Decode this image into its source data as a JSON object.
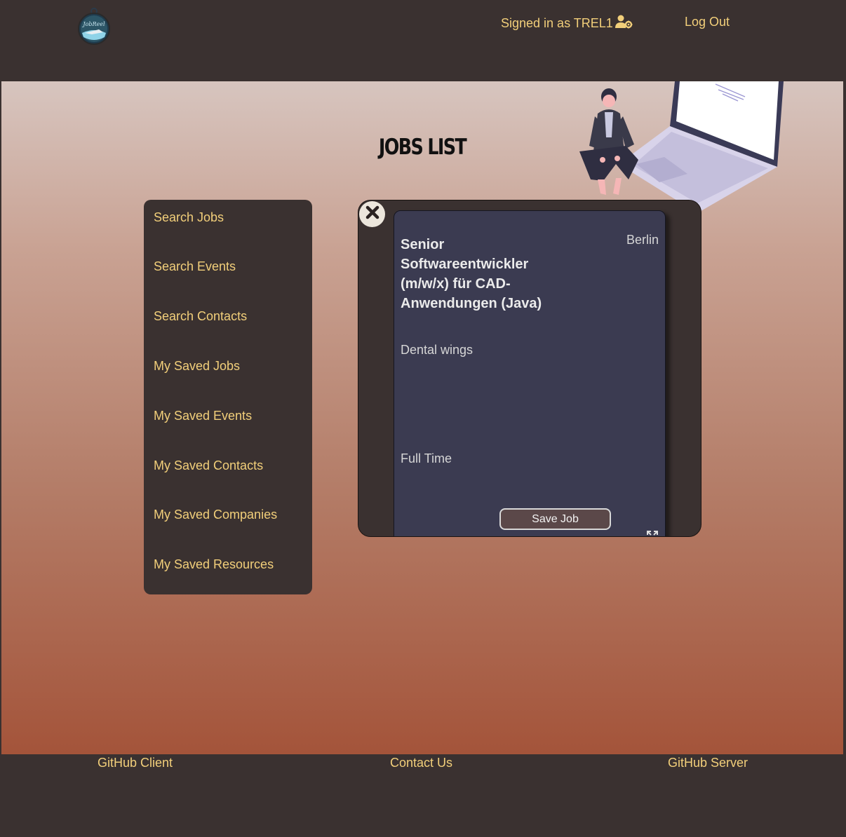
{
  "header": {
    "signed_in_text": "Signed in as TREL1",
    "user_icon": "user-gear-icon",
    "logout_label": "Log Out",
    "logo_icon": "jobreel-logo",
    "logo_text": "JobReel"
  },
  "main": {
    "title": "JOBS LIST",
    "illustration": "woman-sitting-on-laptop-illustration"
  },
  "sidebar": {
    "items": [
      {
        "label": "Search Jobs"
      },
      {
        "label": "Search Events"
      },
      {
        "label": "Search Contacts"
      },
      {
        "label": "My Saved Jobs"
      },
      {
        "label": "My Saved Events"
      },
      {
        "label": "My Saved Contacts"
      },
      {
        "label": "My Saved Companies"
      },
      {
        "label": "My Saved Resources"
      }
    ]
  },
  "job_card": {
    "title": "Senior Softwareentwickler (m/w/x) für CAD-Anwendungen (Java)",
    "location": "Berlin",
    "company": "Dental wings",
    "type": "Full Time",
    "save_label": "Save Job",
    "close_icon": "close-icon",
    "expand_icon": "expand-icon"
  },
  "footer": {
    "github_client": "GitHub Client",
    "contact_us": "Contact Us",
    "github_server": "GitHub Server"
  },
  "colors": {
    "dark_brown": "#3a3130",
    "gold_text": "#f2cf7a",
    "card_bg": "#3b3b51",
    "gradient_top": "#d7c5bf",
    "gradient_bottom": "#a4543a"
  }
}
